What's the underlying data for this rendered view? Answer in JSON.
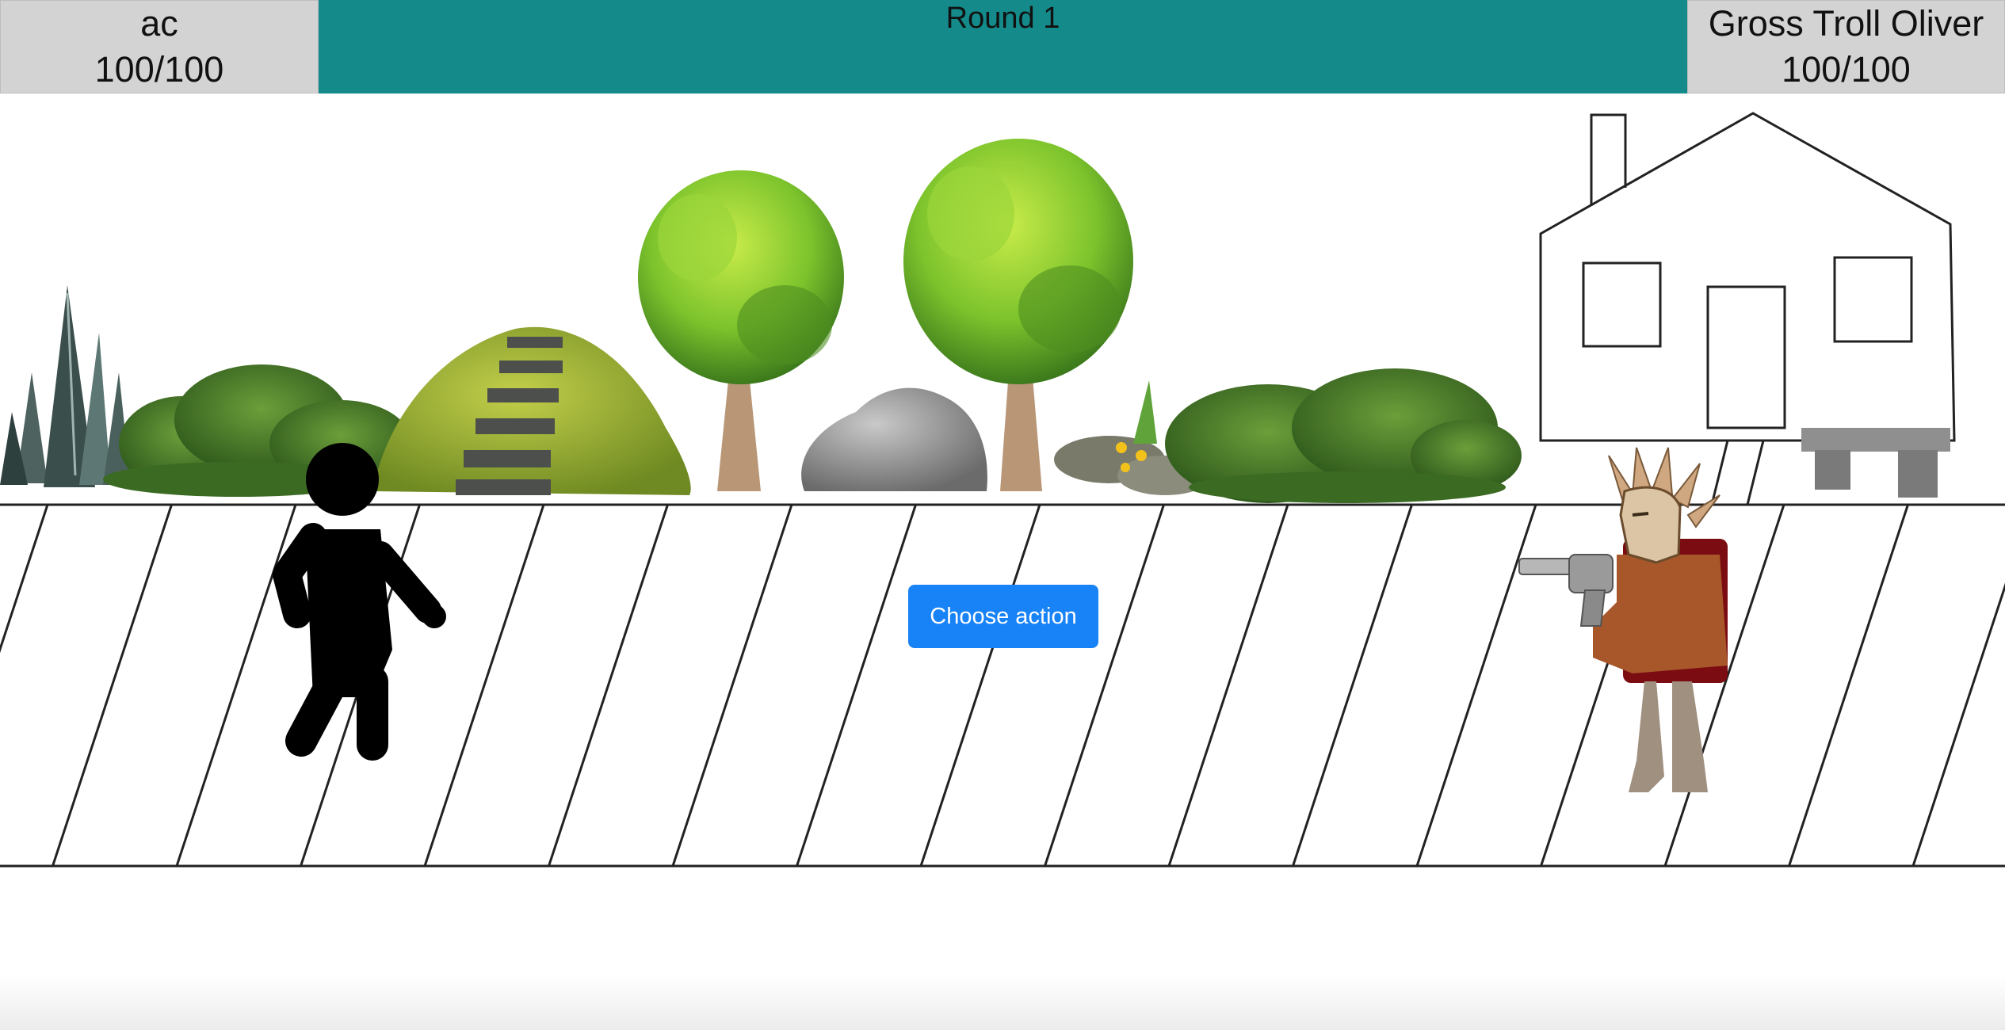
{
  "player": {
    "name": "ac",
    "hp": "100/100"
  },
  "enemy": {
    "name": "Gross Troll Oliver",
    "hp": "100/100"
  },
  "round": {
    "label": "Round 1"
  },
  "actions": {
    "choose_label": "Choose action"
  },
  "colors": {
    "round_bar": "#148a8a",
    "hp_panel": "#d3d3d3",
    "button": "#1883f7",
    "ground_line": "#222222"
  },
  "icons": [
    "crystal-icon",
    "bush-icon",
    "mossy-rock-stairs-icon",
    "tree-icon",
    "boulder-icon",
    "flowers-icon",
    "house-icon",
    "stone-bench-icon",
    "stick-figure-icon",
    "masked-gunslinger-icon",
    "revolver-icon"
  ]
}
